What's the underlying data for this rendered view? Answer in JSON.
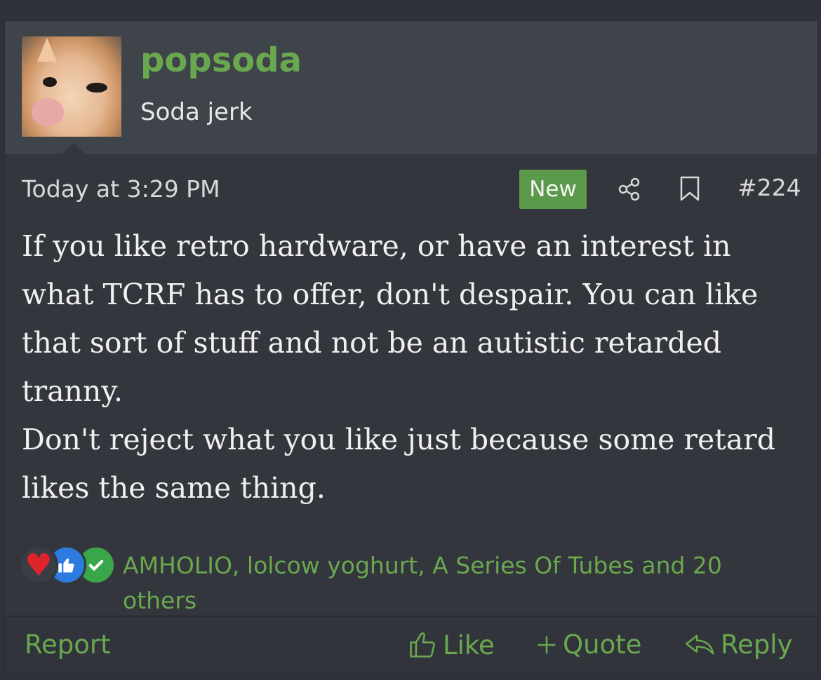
{
  "post": {
    "username": "popsoda",
    "user_title": "Soda jerk",
    "timestamp": "Today at 3:29 PM",
    "badge": "New",
    "post_number": "#224",
    "message_paragraphs": [
      "If you like retro hardware, or have an interest in what TCRF has to offer, don't despair. You can like that sort of stuff and not be an autistic retarded tranny.",
      "Don't reject what you like just because some retard likes the same thing."
    ],
    "reactions": {
      "icons": [
        "heart-icon",
        "thumbs-up-icon",
        "check-icon"
      ],
      "text": "AMHOLIO, lolcow yoghurt, A Series Of Tubes and 20 others"
    },
    "footer": {
      "report": "Report",
      "like": "Like",
      "quote": "Quote",
      "reply": "Reply"
    }
  },
  "colors": {
    "accent_green": "#6aa84f",
    "badge_green": "#5a9a4a",
    "background": "#33363c",
    "header_background": "#3f434a"
  }
}
